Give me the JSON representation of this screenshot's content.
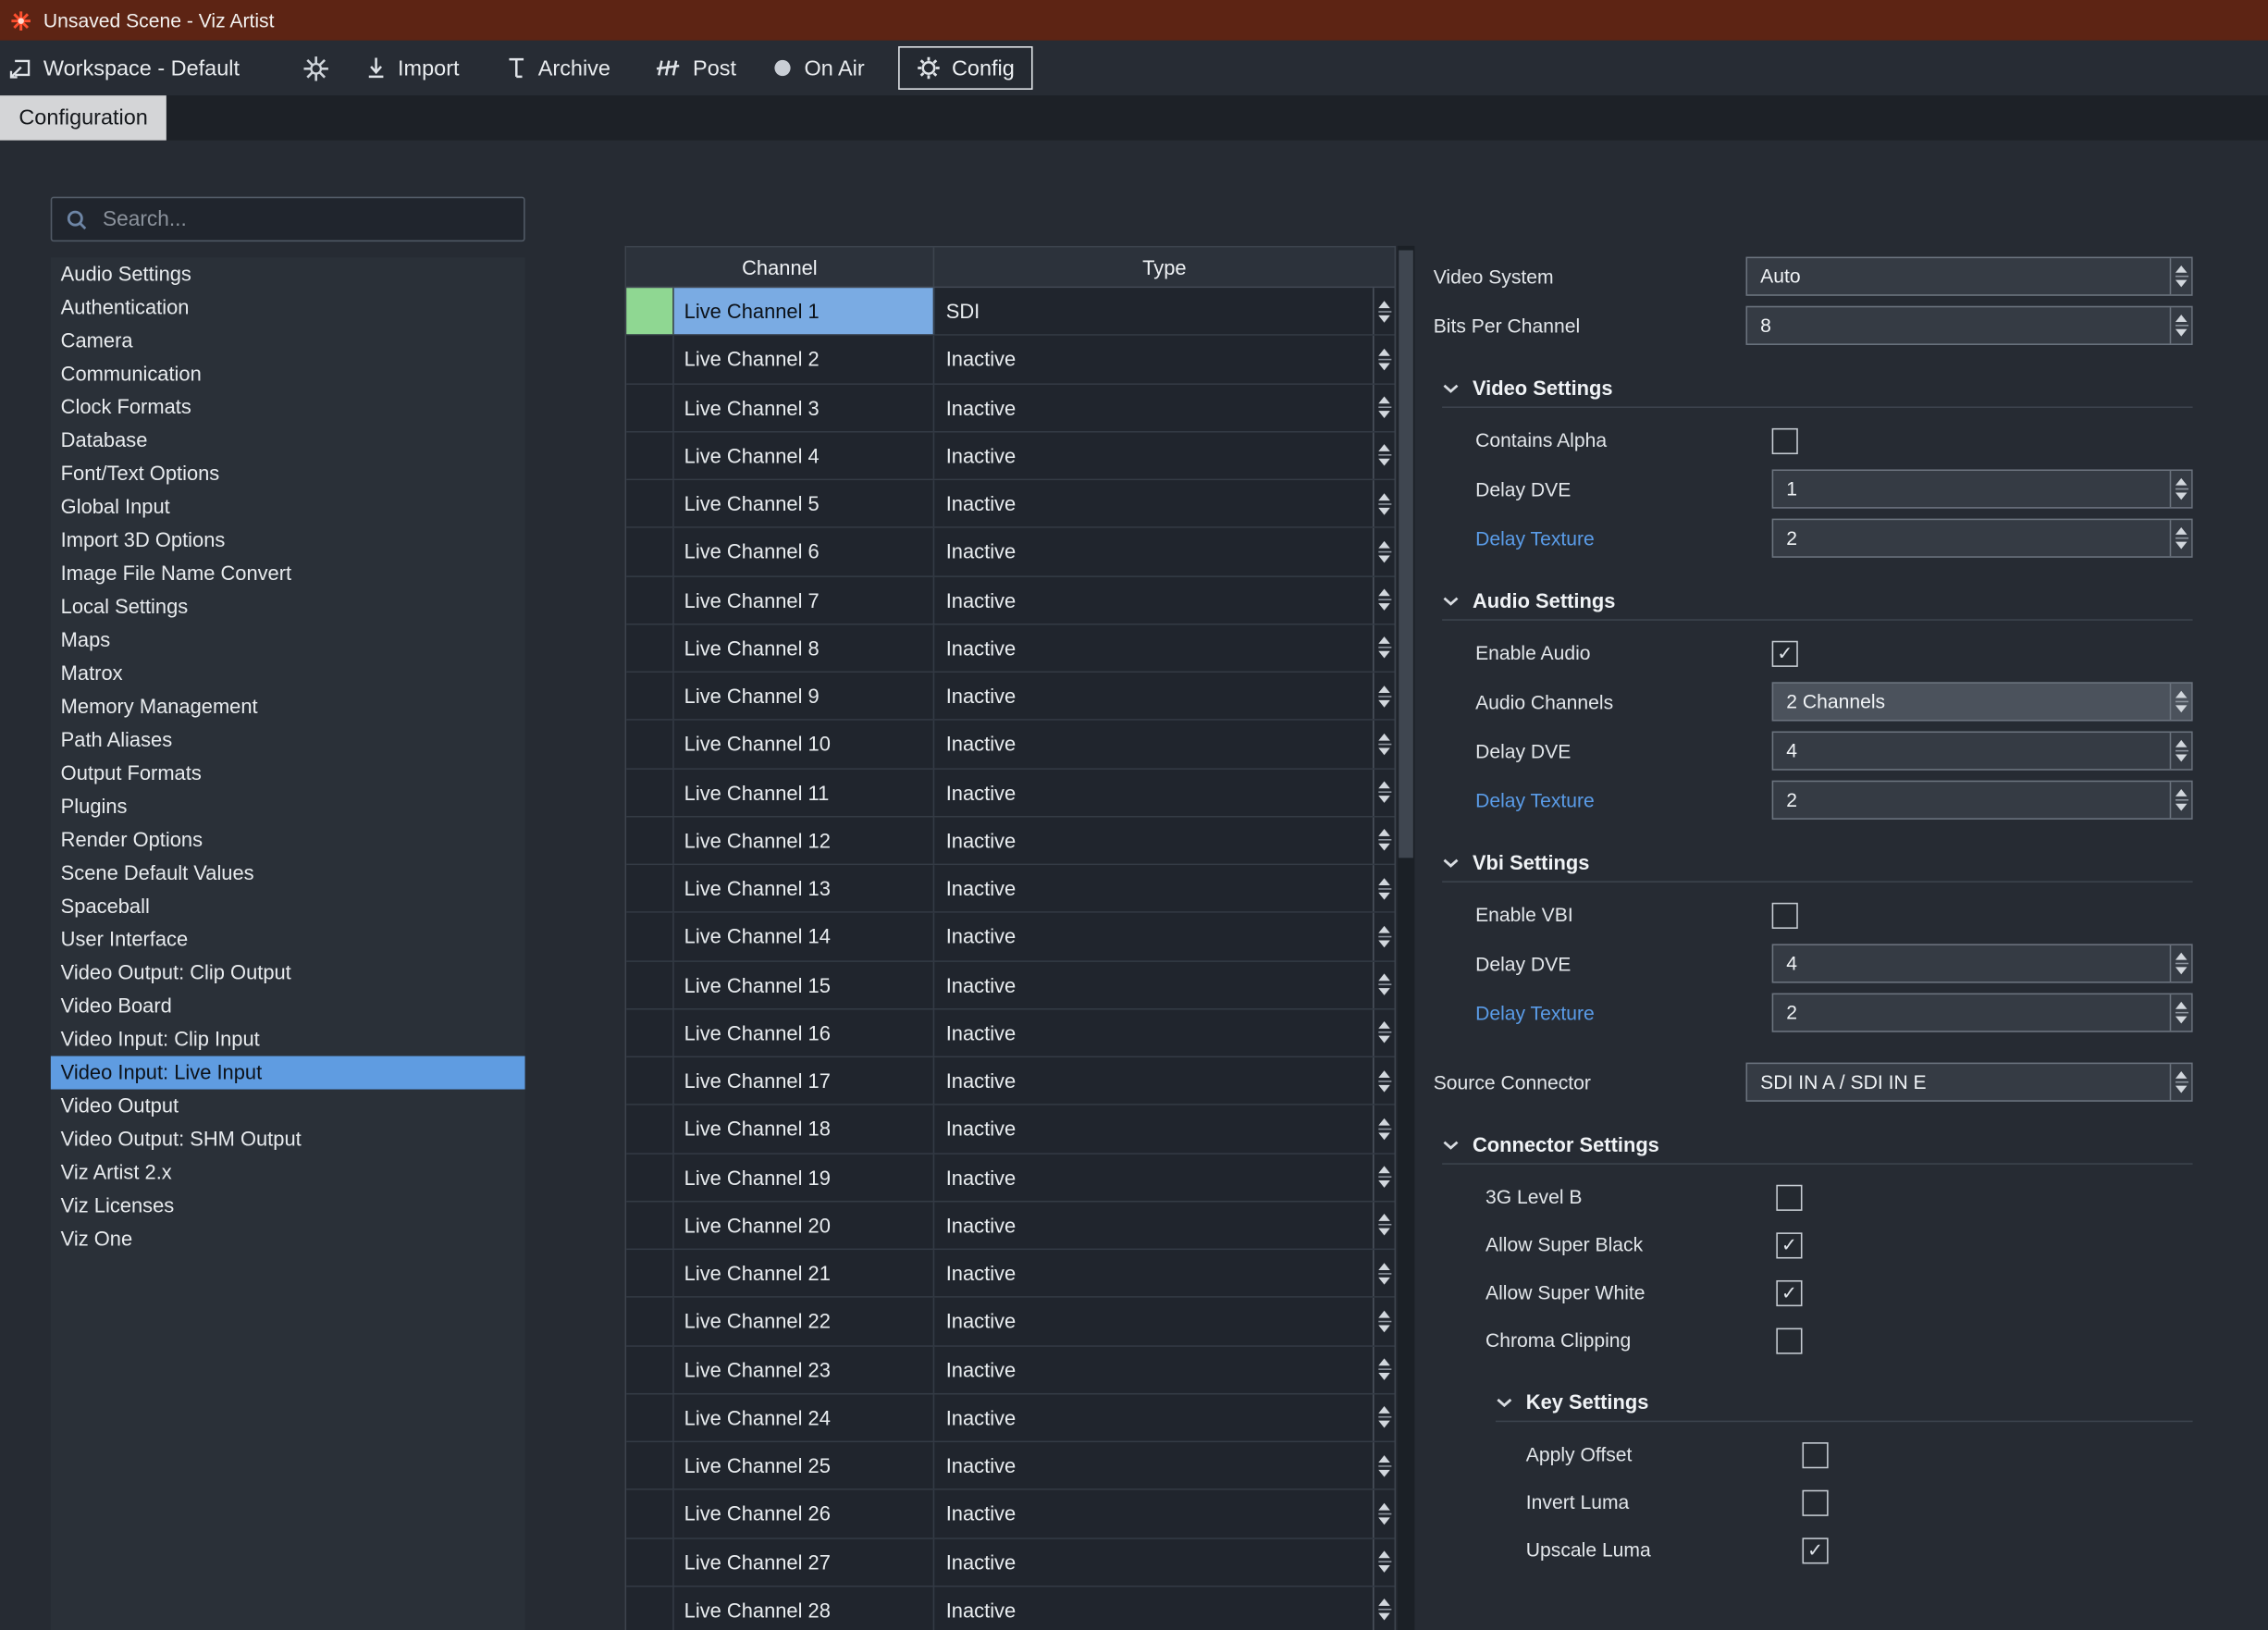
{
  "window": {
    "title": "Unsaved Scene - Viz Artist"
  },
  "toolbar": {
    "workspace_label": "Workspace - Default",
    "import_label": "Import",
    "archive_label": "Archive",
    "post_label": "Post",
    "on_air_label": "On Air",
    "config_label": "Config"
  },
  "tab_bar": {
    "active_tab": "Configuration"
  },
  "sidebar": {
    "search_placeholder": "Search...",
    "items": [
      {
        "label": "Audio Settings"
      },
      {
        "label": "Authentication"
      },
      {
        "label": "Camera"
      },
      {
        "label": "Communication"
      },
      {
        "label": "Clock Formats"
      },
      {
        "label": "Database"
      },
      {
        "label": "Font/Text Options"
      },
      {
        "label": "Global Input"
      },
      {
        "label": "Import 3D Options"
      },
      {
        "label": "Image File Name Convert"
      },
      {
        "label": "Local Settings"
      },
      {
        "label": "Maps"
      },
      {
        "label": "Matrox"
      },
      {
        "label": "Memory Management"
      },
      {
        "label": "Path Aliases"
      },
      {
        "label": "Output Formats"
      },
      {
        "label": "Plugins"
      },
      {
        "label": "Render Options"
      },
      {
        "label": "Scene Default Values"
      },
      {
        "label": "Spaceball"
      },
      {
        "label": "User Interface"
      },
      {
        "label": "Video Output: Clip Output"
      },
      {
        "label": "Video Board"
      },
      {
        "label": "Video Input: Clip Input"
      },
      {
        "label": "Video Input: Live Input",
        "selected": true
      },
      {
        "label": "Video Output"
      },
      {
        "label": "Video Output: SHM Output"
      },
      {
        "label": "Viz Artist 2.x"
      },
      {
        "label": "Viz Licenses"
      },
      {
        "label": "Viz One"
      }
    ]
  },
  "channel_table": {
    "columns": [
      "Channel",
      "Type"
    ],
    "rows": [
      {
        "channel": "Live Channel 1",
        "type": "SDI",
        "selected": true
      },
      {
        "channel": "Live Channel 2",
        "type": "Inactive"
      },
      {
        "channel": "Live Channel 3",
        "type": "Inactive"
      },
      {
        "channel": "Live Channel 4",
        "type": "Inactive"
      },
      {
        "channel": "Live Channel 5",
        "type": "Inactive"
      },
      {
        "channel": "Live Channel 6",
        "type": "Inactive"
      },
      {
        "channel": "Live Channel 7",
        "type": "Inactive"
      },
      {
        "channel": "Live Channel 8",
        "type": "Inactive"
      },
      {
        "channel": "Live Channel 9",
        "type": "Inactive"
      },
      {
        "channel": "Live Channel 10",
        "type": "Inactive"
      },
      {
        "channel": "Live Channel 11",
        "type": "Inactive"
      },
      {
        "channel": "Live Channel 12",
        "type": "Inactive"
      },
      {
        "channel": "Live Channel 13",
        "type": "Inactive"
      },
      {
        "channel": "Live Channel 14",
        "type": "Inactive"
      },
      {
        "channel": "Live Channel 15",
        "type": "Inactive"
      },
      {
        "channel": "Live Channel 16",
        "type": "Inactive"
      },
      {
        "channel": "Live Channel 17",
        "type": "Inactive"
      },
      {
        "channel": "Live Channel 18",
        "type": "Inactive"
      },
      {
        "channel": "Live Channel 19",
        "type": "Inactive"
      },
      {
        "channel": "Live Channel 20",
        "type": "Inactive"
      },
      {
        "channel": "Live Channel 21",
        "type": "Inactive"
      },
      {
        "channel": "Live Channel 22",
        "type": "Inactive"
      },
      {
        "channel": "Live Channel 23",
        "type": "Inactive"
      },
      {
        "channel": "Live Channel 24",
        "type": "Inactive"
      },
      {
        "channel": "Live Channel 25",
        "type": "Inactive"
      },
      {
        "channel": "Live Channel 26",
        "type": "Inactive"
      },
      {
        "channel": "Live Channel 27",
        "type": "Inactive"
      },
      {
        "channel": "Live Channel 28",
        "type": "Inactive"
      }
    ]
  },
  "settings": {
    "rows": [
      {
        "kind": "dropdown",
        "label": "Video System",
        "value": "Auto",
        "level": 0
      },
      {
        "kind": "dropdown",
        "label": "Bits Per Channel",
        "value": "8",
        "level": 0
      },
      {
        "kind": "section",
        "label": "Video Settings",
        "level": 0
      },
      {
        "kind": "checkbox",
        "label": "Contains Alpha",
        "checked": false,
        "level": 1
      },
      {
        "kind": "spinner",
        "label": "Delay DVE",
        "value": "1",
        "level": 1
      },
      {
        "kind": "spinner",
        "label": "Delay Texture",
        "value": "2",
        "level": 1,
        "accent": true
      },
      {
        "kind": "section",
        "label": "Audio Settings",
        "level": 0
      },
      {
        "kind": "checkbox",
        "label": "Enable Audio",
        "checked": true,
        "level": 1
      },
      {
        "kind": "dropdown",
        "label": "Audio Channels",
        "value": "2 Channels",
        "level": 1,
        "highlight": true
      },
      {
        "kind": "spinner",
        "label": "Delay DVE",
        "value": "4",
        "level": 1
      },
      {
        "kind": "spinner",
        "label": "Delay Texture",
        "value": "2",
        "level": 1,
        "accent": true
      },
      {
        "kind": "section",
        "label": "Vbi Settings",
        "level": 0
      },
      {
        "kind": "checkbox",
        "label": "Enable VBI",
        "checked": false,
        "level": 1
      },
      {
        "kind": "spinner",
        "label": "Delay DVE",
        "value": "4",
        "level": 1
      },
      {
        "kind": "spinner",
        "label": "Delay Texture",
        "value": "2",
        "level": 1,
        "accent": true
      },
      {
        "kind": "dropdown",
        "label": "Source Connector",
        "value": "SDI IN A / SDI IN E",
        "level": 0,
        "top_gap": true
      },
      {
        "kind": "section",
        "label": "Connector Settings",
        "level": 0
      },
      {
        "kind": "checkbox",
        "label": "3G Level B",
        "checked": false,
        "level": 2
      },
      {
        "kind": "checkbox",
        "label": "Allow Super Black",
        "checked": true,
        "level": 2
      },
      {
        "kind": "checkbox",
        "label": "Allow Super White",
        "checked": true,
        "level": 2
      },
      {
        "kind": "checkbox",
        "label": "Chroma Clipping",
        "checked": false,
        "level": 2
      },
      {
        "kind": "section",
        "label": "Key Settings",
        "level": 1
      },
      {
        "kind": "checkbox",
        "label": "Apply Offset",
        "checked": false,
        "level": 3
      },
      {
        "kind": "checkbox",
        "label": "Invert Luma",
        "checked": false,
        "level": 3
      },
      {
        "kind": "checkbox",
        "label": "Upscale Luma",
        "checked": true,
        "level": 3
      }
    ]
  },
  "colors": {
    "titlebar_maroon": "#5d2414",
    "selection_blue": "#5f9ce1",
    "row_selection_blue": "#7aabe3",
    "status_green": "#8fd792",
    "accent_label_blue": "#5a9ce8"
  }
}
